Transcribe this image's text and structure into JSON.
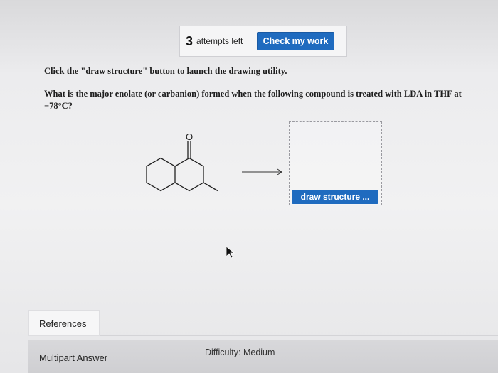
{
  "header": {
    "attempts_count": "3",
    "attempts_label": "attempts left",
    "check_button_label": "Check my work"
  },
  "problem": {
    "instruction": "Click the \"draw structure\" button to launch the drawing utility.",
    "question": "What is the major enolate (or carbanion) formed when the following compound is treated with LDA in THF at −78°C?",
    "oxygen_atom_label": "O",
    "draw_button_label": "draw structure ..."
  },
  "tabs": {
    "references_label": "References"
  },
  "footer": {
    "multipart_label": "Multipart Answer",
    "difficulty_label": "Difficulty: Medium"
  }
}
